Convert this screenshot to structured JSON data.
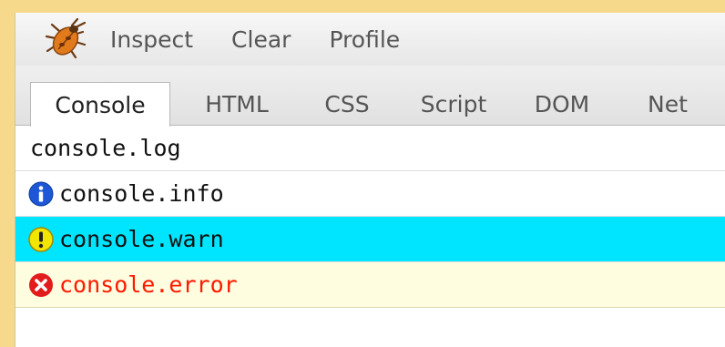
{
  "colors": {
    "background": "#f6d98a",
    "warn_row": "#00e5ff",
    "error_row": "#fffde0",
    "error_text": "#ff1a00",
    "info_icon": "#1d57d6",
    "warn_icon": "#f2e600",
    "error_icon": "#e21b1b"
  },
  "toolbar": {
    "logo_icon": "firebug-icon",
    "inspect_label": "Inspect",
    "clear_label": "Clear",
    "profile_label": "Profile"
  },
  "tabs": [
    {
      "label": "Console",
      "active": true
    },
    {
      "label": "HTML",
      "active": false
    },
    {
      "label": "CSS",
      "active": false
    },
    {
      "label": "Script",
      "active": false
    },
    {
      "label": "DOM",
      "active": false
    },
    {
      "label": "Net",
      "active": false
    }
  ],
  "console": {
    "entries": [
      {
        "level": "log",
        "icon": null,
        "text": "console.log"
      },
      {
        "level": "info",
        "icon": "info-icon",
        "text": "console.info"
      },
      {
        "level": "warn",
        "icon": "warning-icon",
        "text": "console.warn"
      },
      {
        "level": "error",
        "icon": "error-icon",
        "text": "console.error"
      }
    ]
  }
}
